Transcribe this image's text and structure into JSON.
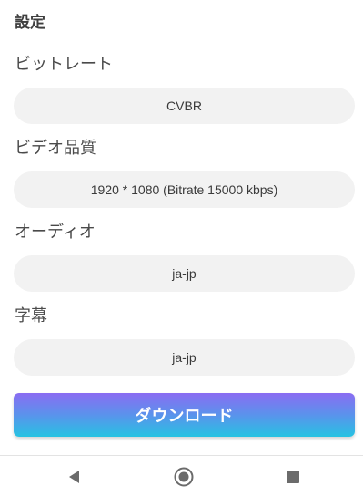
{
  "header": {
    "title": "設定"
  },
  "settings": {
    "bitrate": {
      "label": "ビットレート",
      "value": "CVBR"
    },
    "video_quality": {
      "label": "ビデオ品質",
      "value": "1920 * 1080 (Bitrate 15000 kbps)"
    },
    "audio": {
      "label": "オーディオ",
      "value": "ja-jp"
    },
    "subtitles": {
      "label": "字幕",
      "value": "ja-jp"
    }
  },
  "actions": {
    "download_label": "ダウンロード"
  },
  "navbar": {
    "icons": [
      "back-icon",
      "home-icon",
      "recents-icon"
    ]
  },
  "colors": {
    "button_gradient_top": "#8a6cf2",
    "button_gradient_bottom": "#26c3e2",
    "field_bg": "#f2f2f2"
  }
}
